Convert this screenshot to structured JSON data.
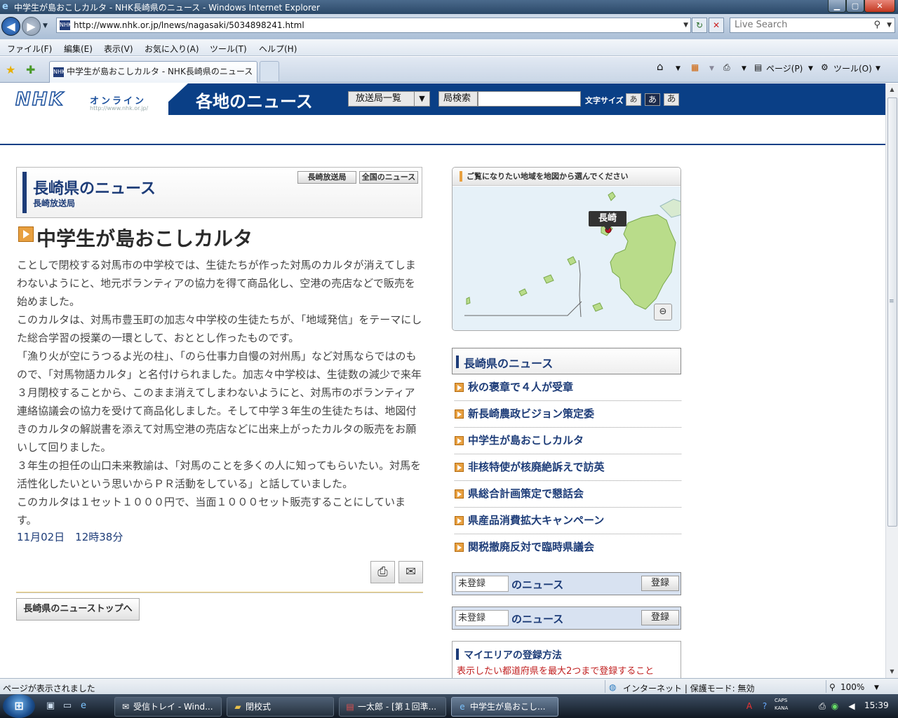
{
  "window": {
    "title": "中学生が島おこしカルタ - NHK長崎県のニュース - Windows Internet Explorer",
    "min_glyph": "▁",
    "max_glyph": "▢",
    "close_glyph": "✕"
  },
  "addressbar": {
    "url": "http://www.nhk.or.jp/lnews/nagasaki/5034898241.html",
    "search_placeholder": "Live Search"
  },
  "menu": [
    "ファイル(F)",
    "編集(E)",
    "表示(V)",
    "お気に入り(A)",
    "ツール(T)",
    "ヘルプ(H)"
  ],
  "tab": {
    "label": "中学生が島おこしカルタ - NHK長崎県のニュース"
  },
  "commandbar": {
    "page_label": "ページ(P)",
    "tools_label": "ツール(O)"
  },
  "nhk": {
    "logo": "NHK",
    "online": "オンライン",
    "url": "http://www.nhk.or.jp/",
    "section_title": "各地のニュース",
    "station_select": "放送局一覧",
    "station_search_label": "局検索",
    "fontsize_label": "文字サイズ",
    "fontsize": [
      "あ",
      "あ",
      "あ"
    ]
  },
  "pref": {
    "title": "長崎県のニュース",
    "subtitle": "長崎放送局",
    "btn_station": "長崎放送局",
    "btn_national": "全国のニュース"
  },
  "article": {
    "title": "中学生が島おこしカルタ",
    "paragraphs": [
      "ことしで閉校する対馬市の中学校では、生徒たちが作った対馬のカルタが消えてしまわないようにと、地元ボランティアの協力を得て商品化し、空港の売店などで販売を始めました。",
      "このカルタは、対馬市豊玉町の加志々中学校の生徒たちが、「地域発信」をテーマにした総合学習の授業の一環として、おととし作ったものです。",
      "「漁り火が空にうつるよ光の柱」、「のら仕事力自慢の対州馬」など対馬ならではのもので、「対馬物語カルタ」と名付けられました。加志々中学校は、生徒数の減少で来年３月閉校することから、このまま消えてしまわないようにと、対馬市のボランティア連絡協議会の協力を受けて商品化しました。そして中学３年生の生徒たちは、地図付きのカルタの解説書を添えて対馬空港の売店などに出来上がったカルタの販売をお願いして回りました。",
      "３年生の担任の山口未来教諭は、「対馬のことを多くの人に知ってもらいたい。対馬を活性化したいという思いからＰＲ活動をしている」と話していました。",
      "このカルタは１セット１０００円で、当面１０００セット販売することにしています。"
    ],
    "timestamp": "11月02日　12時38分",
    "back_to_top": "長崎県のニューストップへ"
  },
  "map": {
    "header": "ご覧になりたい地域を地図から選んでください",
    "label": "長崎"
  },
  "news_list": {
    "title": "長崎県のニュース",
    "items": [
      "秋の褒章で４人が受章",
      "新長崎農政ビジョン策定委",
      "中学生が島おこしカルタ",
      "非核特使が核廃絶訴えで訪英",
      "県総合計画策定で懇話会",
      "県産品消費拡大キャンペーン",
      "関税撤廃反対で臨時県議会"
    ]
  },
  "register": [
    {
      "value": "未登録",
      "suffix": "のニュース",
      "button": "登録"
    },
    {
      "value": "未登録",
      "suffix": "のニュース",
      "button": "登録"
    }
  ],
  "myarea": {
    "title": "マイエリアの登録方法",
    "desc": "表示したい都道府県を最大2つまで登録すること"
  },
  "statusbar": {
    "status": "ページが表示されました",
    "zone": "インターネット | 保護モード: 無効",
    "zoom": "100%"
  },
  "taskbar": {
    "tasks": [
      "受信トレイ - Wind...",
      "閉校式",
      "一太郎 - [第１回準...",
      "中学生が島おこし..."
    ],
    "clock": "15:39",
    "caps": "CAPS",
    "kana": "KANA"
  },
  "icons": {
    "ie": "ie-icon",
    "back": "back-arrow-icon",
    "forward": "forward-arrow-icon",
    "refresh": "refresh-icon",
    "stop": "stop-icon",
    "search": "search-icon",
    "favorites": "favorites-star-icon",
    "add_favorite": "add-favorite-icon",
    "home": "home-icon",
    "feeds": "feeds-icon",
    "print": "print-icon",
    "mail": "mail-icon",
    "zoom_out": "zoom-out-icon"
  },
  "colors": {
    "nhk_blue": "#0a3f86",
    "link_blue": "#1d3c78",
    "bullet_orange": "#e8a040",
    "note_red": "#c02020"
  }
}
